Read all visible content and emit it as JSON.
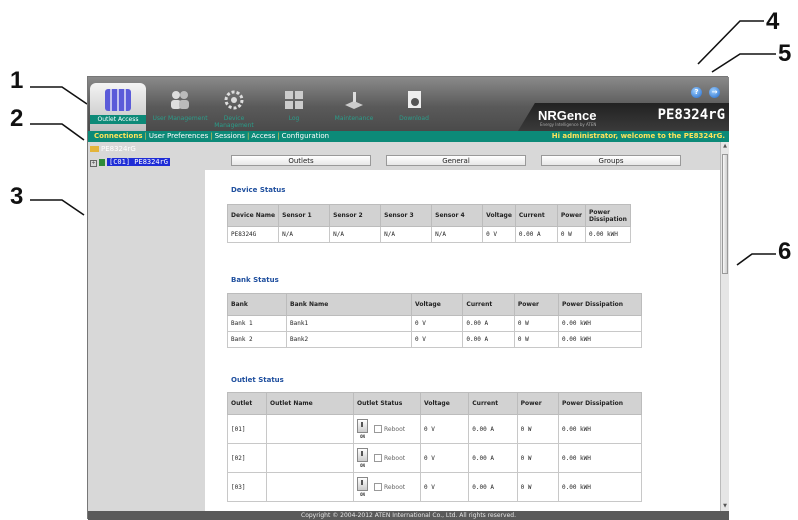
{
  "callouts": [
    "1",
    "2",
    "3",
    "4",
    "5",
    "6"
  ],
  "toolbar": {
    "items": [
      {
        "label": "Outlet Access",
        "icon": "outlet-grid-icon"
      },
      {
        "label": "User Management",
        "icon": "users-icon"
      },
      {
        "label": "Device Management",
        "icon": "gear-icon"
      },
      {
        "label": "Log",
        "icon": "log-grid-icon"
      },
      {
        "label": "Maintenance",
        "icon": "maintenance-icon"
      },
      {
        "label": "Download",
        "icon": "download-icon"
      }
    ]
  },
  "brand": {
    "logo": "NRGence",
    "tagline": "Energy Intelligence by ATEN",
    "model": "PE8324rG"
  },
  "help_icon": "?",
  "logout_icon": "→",
  "menu": {
    "items": [
      "Connections",
      "User Preferences",
      "Sessions",
      "Access",
      "Configuration"
    ],
    "welcome": "Hi administrator, welcome to the PE8324rG."
  },
  "tree": {
    "root": "PE8324rG",
    "node": "[C01] PE8324rG"
  },
  "tabs": [
    "Outlets",
    "General",
    "Groups"
  ],
  "device_status": {
    "title": "Device Status",
    "headers": [
      "Device Name",
      "Sensor 1",
      "Sensor 2",
      "Sensor 3",
      "Sensor 4",
      "Voltage",
      "Current",
      "Power",
      "Power Dissipation"
    ],
    "rows": [
      [
        "PE8324G",
        "N/A",
        "N/A",
        "N/A",
        "N/A",
        "0 V",
        "0.00 A",
        "0 W",
        "0.00 kWH"
      ]
    ]
  },
  "bank_status": {
    "title": "Bank Status",
    "headers": [
      "Bank",
      "Bank Name",
      "Voltage",
      "Current",
      "Power",
      "Power Dissipation"
    ],
    "rows": [
      [
        "Bank 1",
        "Bank1",
        "0 V",
        "0.00 A",
        "0 W",
        "0.00 kWH"
      ],
      [
        "Bank 2",
        "Bank2",
        "0 V",
        "0.00 A",
        "0 W",
        "0.00 kWH"
      ]
    ]
  },
  "outlet_status": {
    "title": "Outlet Status",
    "headers": [
      "Outlet",
      "Outlet Name",
      "Outlet Status",
      "Voltage",
      "Current",
      "Power",
      "Power Dissipation"
    ],
    "on_label": "ON",
    "reboot_label": "Reboot",
    "rows": [
      [
        "[01]",
        "",
        "",
        "0 V",
        "0.00 A",
        "0 W",
        "0.00 kWH"
      ],
      [
        "[02]",
        "",
        "",
        "0 V",
        "0.00 A",
        "0 W",
        "0.00 kWH"
      ],
      [
        "[03]",
        "",
        "",
        "0 V",
        "0.00 A",
        "0 W",
        "0.00 kWH"
      ]
    ]
  },
  "footer": "Copyright © 2004-2012 ATEN International Co., Ltd. All rights reserved.",
  "colors": {
    "menu_bar": "#0c8a78",
    "selection": "#1f2dd6",
    "section_title": "#1f4f9e"
  }
}
